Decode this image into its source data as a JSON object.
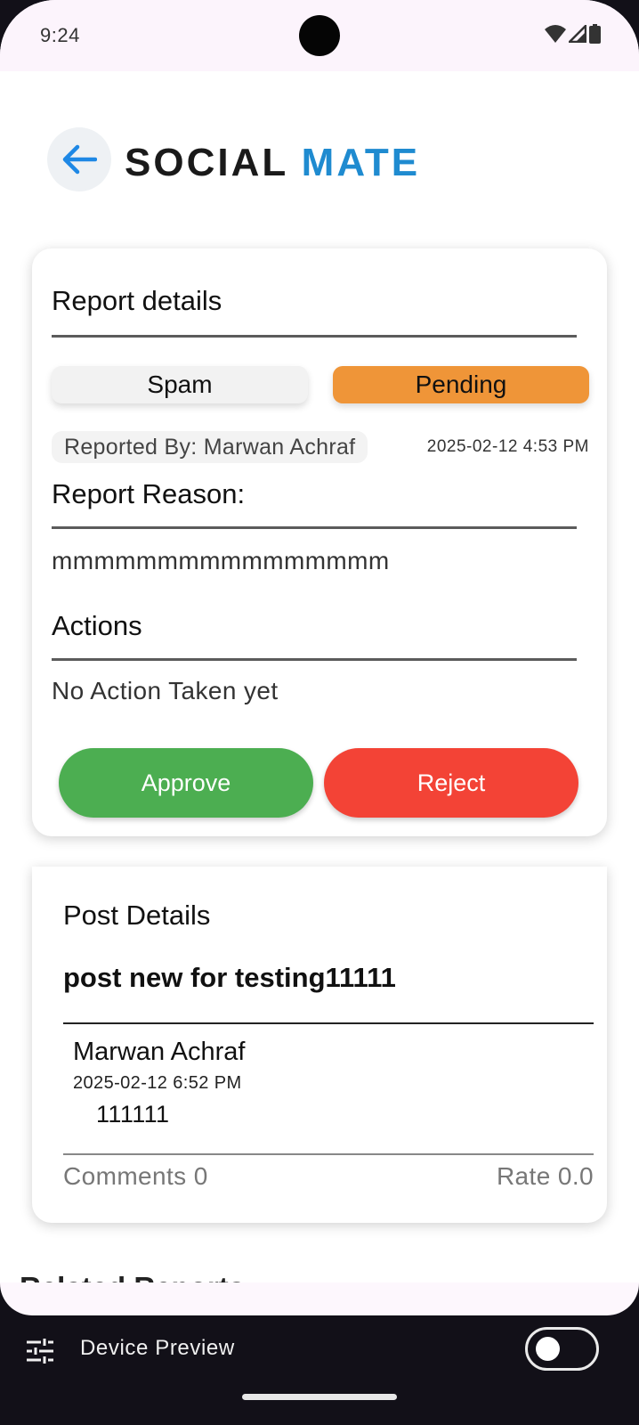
{
  "status_bar": {
    "time": "9:24"
  },
  "header": {
    "logo_part1": "SOCIAL",
    "logo_part2": "MATE",
    "brand_color": "#1f8bd0"
  },
  "report": {
    "title": "Report details",
    "type_label": "Spam",
    "status_label": "Pending",
    "status_color": "#ef9538",
    "reported_by": "Reported By: Marwan Achraf",
    "date": "2025-02-12 4:53 PM",
    "reason_title": "Report Reason:",
    "reason_text": "mmmmmmmmmmmmmmmm",
    "actions_title": "Actions",
    "actions_text": "No Action Taken yet",
    "approve_label": "Approve",
    "reject_label": "Reject",
    "approve_color": "#4cae51",
    "reject_color": "#f34336"
  },
  "post": {
    "title": "Post Details",
    "post_title": "post new for testing11111",
    "author": "Marwan Achraf",
    "date": "2025-02-12 6:52 PM",
    "body": "111111",
    "comments": "Comments 0",
    "rate": "Rate 0.0"
  },
  "related": {
    "title_partial": "Related Reports"
  },
  "device_preview": {
    "label": "Device Preview",
    "toggle_on": false
  }
}
